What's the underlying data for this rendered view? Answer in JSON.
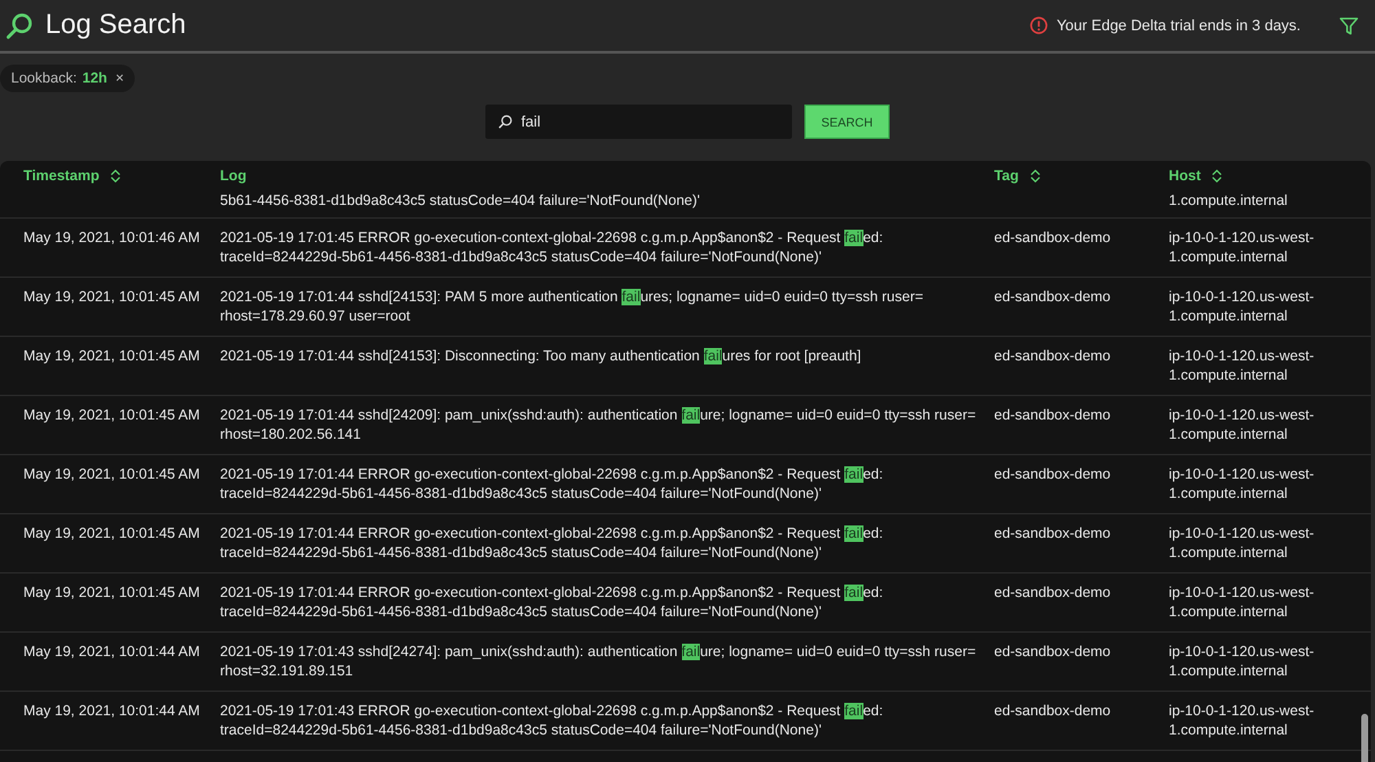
{
  "header": {
    "title": "Log Search",
    "notice": "Your Edge Delta trial ends in 3 days."
  },
  "filters": [
    {
      "label": "Lookback:",
      "value": "12h",
      "remove": "×"
    }
  ],
  "search": {
    "value": "fail",
    "button": "SEARCH"
  },
  "table": {
    "columns": [
      {
        "label": "Timestamp",
        "sortable": true
      },
      {
        "label": "Log",
        "sortable": false
      },
      {
        "label": "Tag",
        "sortable": true
      },
      {
        "label": "Host",
        "sortable": true
      }
    ],
    "rows": [
      {
        "log": [
          {
            "text": "5b61-4456-8381-d1bd9a8c43c5 statusCode=404 failure='NotFound(None)'",
            "highlight": false
          }
        ],
        "host": "1.compute.internal"
      },
      {
        "timestamp": "May 19, 2021, 10:01:46 AM",
        "log": [
          {
            "text": "2021-05-19 17:01:45 ERROR go-execution-context-global-22698 c.g.m.p.App$anon$2 - Request ",
            "highlight": false
          },
          {
            "text": "fail",
            "highlight": true
          },
          {
            "text": "ed: traceId=8244229d-5b61-4456-8381-d1bd9a8c43c5 statusCode=404 failure='NotFound(None)'",
            "highlight": false
          }
        ],
        "tag": "ed-sandbox-demo",
        "host": "ip-10-0-1-120.us-west-1.compute.internal"
      },
      {
        "timestamp": "May 19, 2021, 10:01:45 AM",
        "log": [
          {
            "text": "2021-05-19 17:01:44 sshd[24153]: PAM 5 more authentication ",
            "highlight": false
          },
          {
            "text": "fail",
            "highlight": true
          },
          {
            "text": "ures; logname= uid=0 euid=0 tty=ssh ruser= rhost=178.29.60.97 user=root",
            "highlight": false
          }
        ],
        "tag": "ed-sandbox-demo",
        "host": "ip-10-0-1-120.us-west-1.compute.internal"
      },
      {
        "timestamp": "May 19, 2021, 10:01:45 AM",
        "log": [
          {
            "text": "2021-05-19 17:01:44 sshd[24153]: Disconnecting: Too many authentication ",
            "highlight": false
          },
          {
            "text": "fail",
            "highlight": true
          },
          {
            "text": "ures for root [preauth]",
            "highlight": false
          }
        ],
        "tag": "ed-sandbox-demo",
        "host": "ip-10-0-1-120.us-west-1.compute.internal"
      },
      {
        "timestamp": "May 19, 2021, 10:01:45 AM",
        "log": [
          {
            "text": "2021-05-19 17:01:44 sshd[24209]: pam_unix(sshd:auth): authentication ",
            "highlight": false
          },
          {
            "text": "fail",
            "highlight": true
          },
          {
            "text": "ure; logname= uid=0 euid=0 tty=ssh ruser= rhost=180.202.56.141",
            "highlight": false
          }
        ],
        "tag": "ed-sandbox-demo",
        "host": "ip-10-0-1-120.us-west-1.compute.internal"
      },
      {
        "timestamp": "May 19, 2021, 10:01:45 AM",
        "log": [
          {
            "text": "2021-05-19 17:01:44 ERROR go-execution-context-global-22698 c.g.m.p.App$anon$2 - Request ",
            "highlight": false
          },
          {
            "text": "fail",
            "highlight": true
          },
          {
            "text": "ed: traceId=8244229d-5b61-4456-8381-d1bd9a8c43c5 statusCode=404 failure='NotFound(None)'",
            "highlight": false
          }
        ],
        "tag": "ed-sandbox-demo",
        "host": "ip-10-0-1-120.us-west-1.compute.internal"
      },
      {
        "timestamp": "May 19, 2021, 10:01:45 AM",
        "log": [
          {
            "text": "2021-05-19 17:01:44 ERROR go-execution-context-global-22698 c.g.m.p.App$anon$2 - Request ",
            "highlight": false
          },
          {
            "text": "fail",
            "highlight": true
          },
          {
            "text": "ed: traceId=8244229d-5b61-4456-8381-d1bd9a8c43c5 statusCode=404 failure='NotFound(None)'",
            "highlight": false
          }
        ],
        "tag": "ed-sandbox-demo",
        "host": "ip-10-0-1-120.us-west-1.compute.internal"
      },
      {
        "timestamp": "May 19, 2021, 10:01:45 AM",
        "log": [
          {
            "text": "2021-05-19 17:01:44 ERROR go-execution-context-global-22698 c.g.m.p.App$anon$2 - Request ",
            "highlight": false
          },
          {
            "text": "fail",
            "highlight": true
          },
          {
            "text": "ed: traceId=8244229d-5b61-4456-8381-d1bd9a8c43c5 statusCode=404 failure='NotFound(None)'",
            "highlight": false
          }
        ],
        "tag": "ed-sandbox-demo",
        "host": "ip-10-0-1-120.us-west-1.compute.internal"
      },
      {
        "timestamp": "May 19, 2021, 10:01:44 AM",
        "log": [
          {
            "text": "2021-05-19 17:01:43 sshd[24274]: pam_unix(sshd:auth): authentication ",
            "highlight": false
          },
          {
            "text": "fail",
            "highlight": true
          },
          {
            "text": "ure; logname= uid=0 euid=0 tty=ssh ruser= rhost=32.191.89.151",
            "highlight": false
          }
        ],
        "tag": "ed-sandbox-demo",
        "host": "ip-10-0-1-120.us-west-1.compute.internal"
      },
      {
        "timestamp": "May 19, 2021, 10:01:44 AM",
        "log": [
          {
            "text": "2021-05-19 17:01:43 ERROR go-execution-context-global-22698 c.g.m.p.App$anon$2 - Request ",
            "highlight": false
          },
          {
            "text": "fail",
            "highlight": true
          },
          {
            "text": "ed: traceId=8244229d-5b61-4456-8381-d1bd9a8c43c5 statusCode=404 failure='NotFound(None)'",
            "highlight": false
          }
        ],
        "tag": "ed-sandbox-demo",
        "host": "ip-10-0-1-120.us-west-1.compute.internal"
      }
    ]
  }
}
